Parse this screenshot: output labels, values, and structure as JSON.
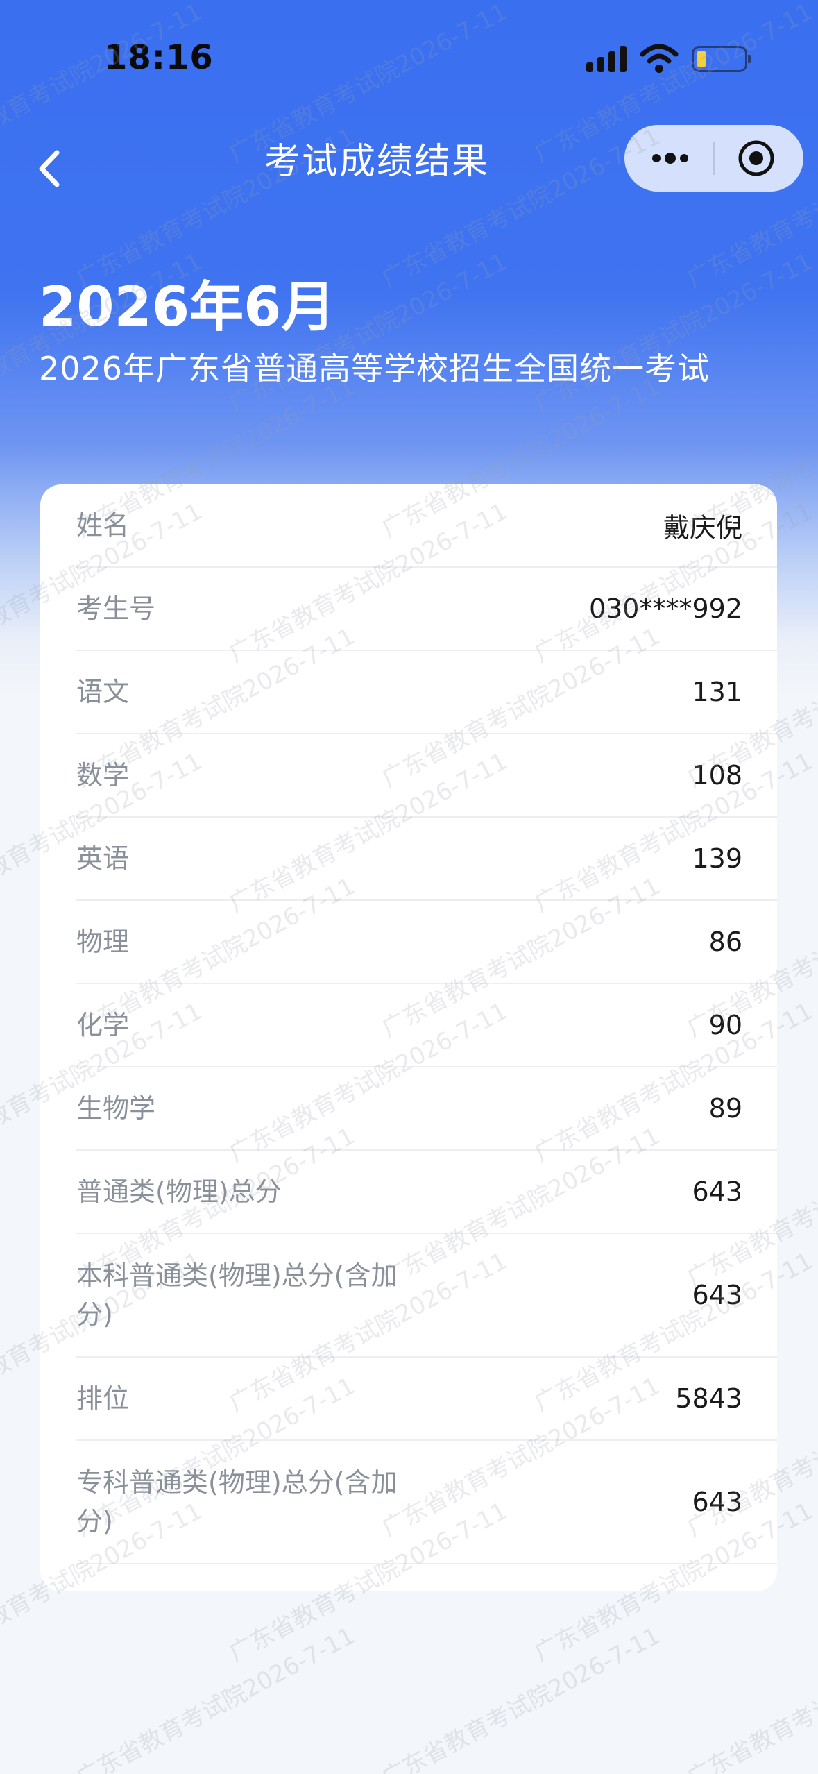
{
  "status_bar": {
    "time": "18:16"
  },
  "nav": {
    "title": "考试成绩结果"
  },
  "header": {
    "date": "2026年6月",
    "exam_name": "2026年广东省普通高等学校招生全国统一考试"
  },
  "watermark": "广东省教育考试院2026-7-11",
  "results": [
    {
      "label": "姓名",
      "value": "戴庆倪"
    },
    {
      "label": "考生号",
      "value": "030****992"
    },
    {
      "label": "语文",
      "value": "131"
    },
    {
      "label": "数学",
      "value": "108"
    },
    {
      "label": "英语",
      "value": "139"
    },
    {
      "label": "物理",
      "value": "86"
    },
    {
      "label": "化学",
      "value": "90"
    },
    {
      "label": "生物学",
      "value": "89"
    },
    {
      "label": "普通类(物理)总分",
      "value": "643"
    },
    {
      "label": "本科普通类(物理)总分(含加分)",
      "value": "643"
    },
    {
      "label": "排位",
      "value": "5843"
    },
    {
      "label": "专科普通类(物理)总分(含加分)",
      "value": "643"
    }
  ]
}
